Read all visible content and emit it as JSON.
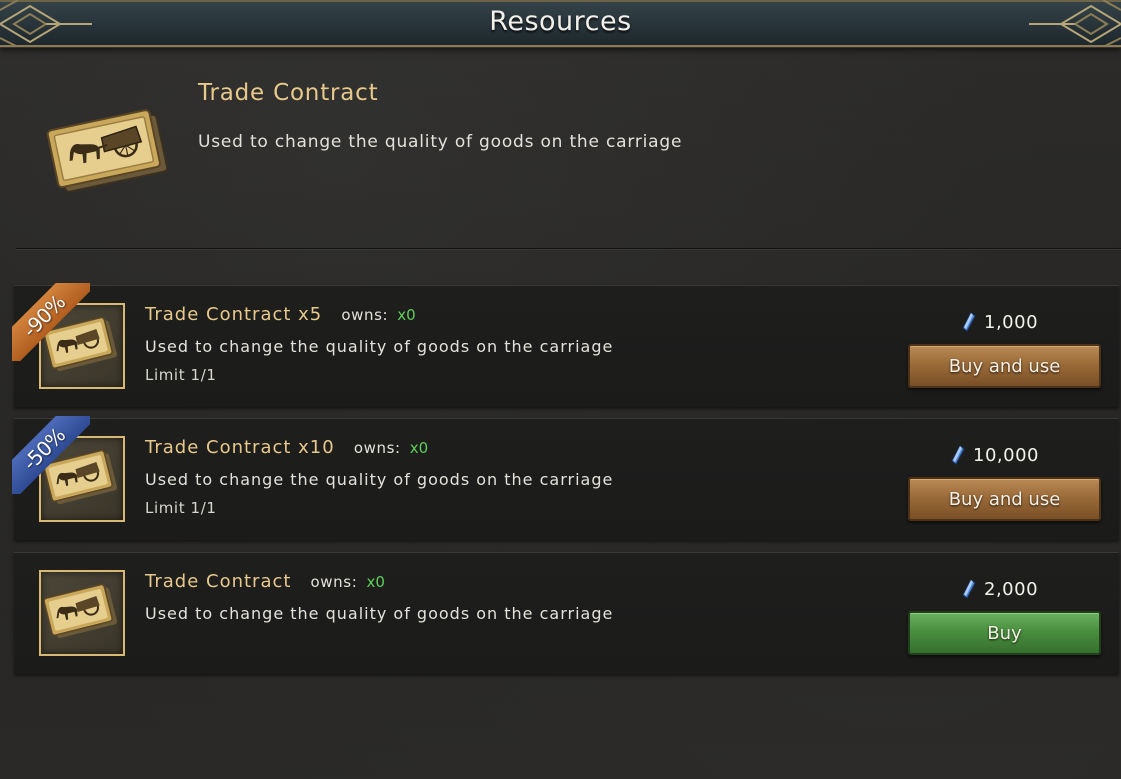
{
  "window": {
    "title": "Resources"
  },
  "header": {
    "name": "Trade Contract",
    "description": "Used to change the quality of goods on the carriage"
  },
  "items": [
    {
      "badge": "-90%",
      "name": "Trade Contract x5",
      "owns_label": "owns:",
      "owns_value": "x0",
      "description": "Used to change the quality of goods on the carriage",
      "limit": "Limit 1/1",
      "price": "1,000",
      "button": "Buy and use"
    },
    {
      "badge": "-50%",
      "name": "Trade Contract x10",
      "owns_label": "owns:",
      "owns_value": "x0",
      "description": "Used to change the quality of goods on the carriage",
      "limit": "Limit 1/1",
      "price": "10,000",
      "button": "Buy and use"
    },
    {
      "name": "Trade Contract",
      "owns_label": "owns:",
      "owns_value": "x0",
      "description": "Used to change the quality of goods on the carriage",
      "price": "2,000",
      "button": "Buy"
    }
  ],
  "icons": {
    "currency": "blue-crystal-icon",
    "item": "trade-contract-carriage-icon"
  },
  "colors": {
    "gold_text": "#e8c98c",
    "owns_green": "#5fcf5a",
    "badge_orange": "#c9742f",
    "badge_blue": "#3d5aa6",
    "button_orange": "#9b6b39",
    "button_green": "#4a8f3f"
  }
}
